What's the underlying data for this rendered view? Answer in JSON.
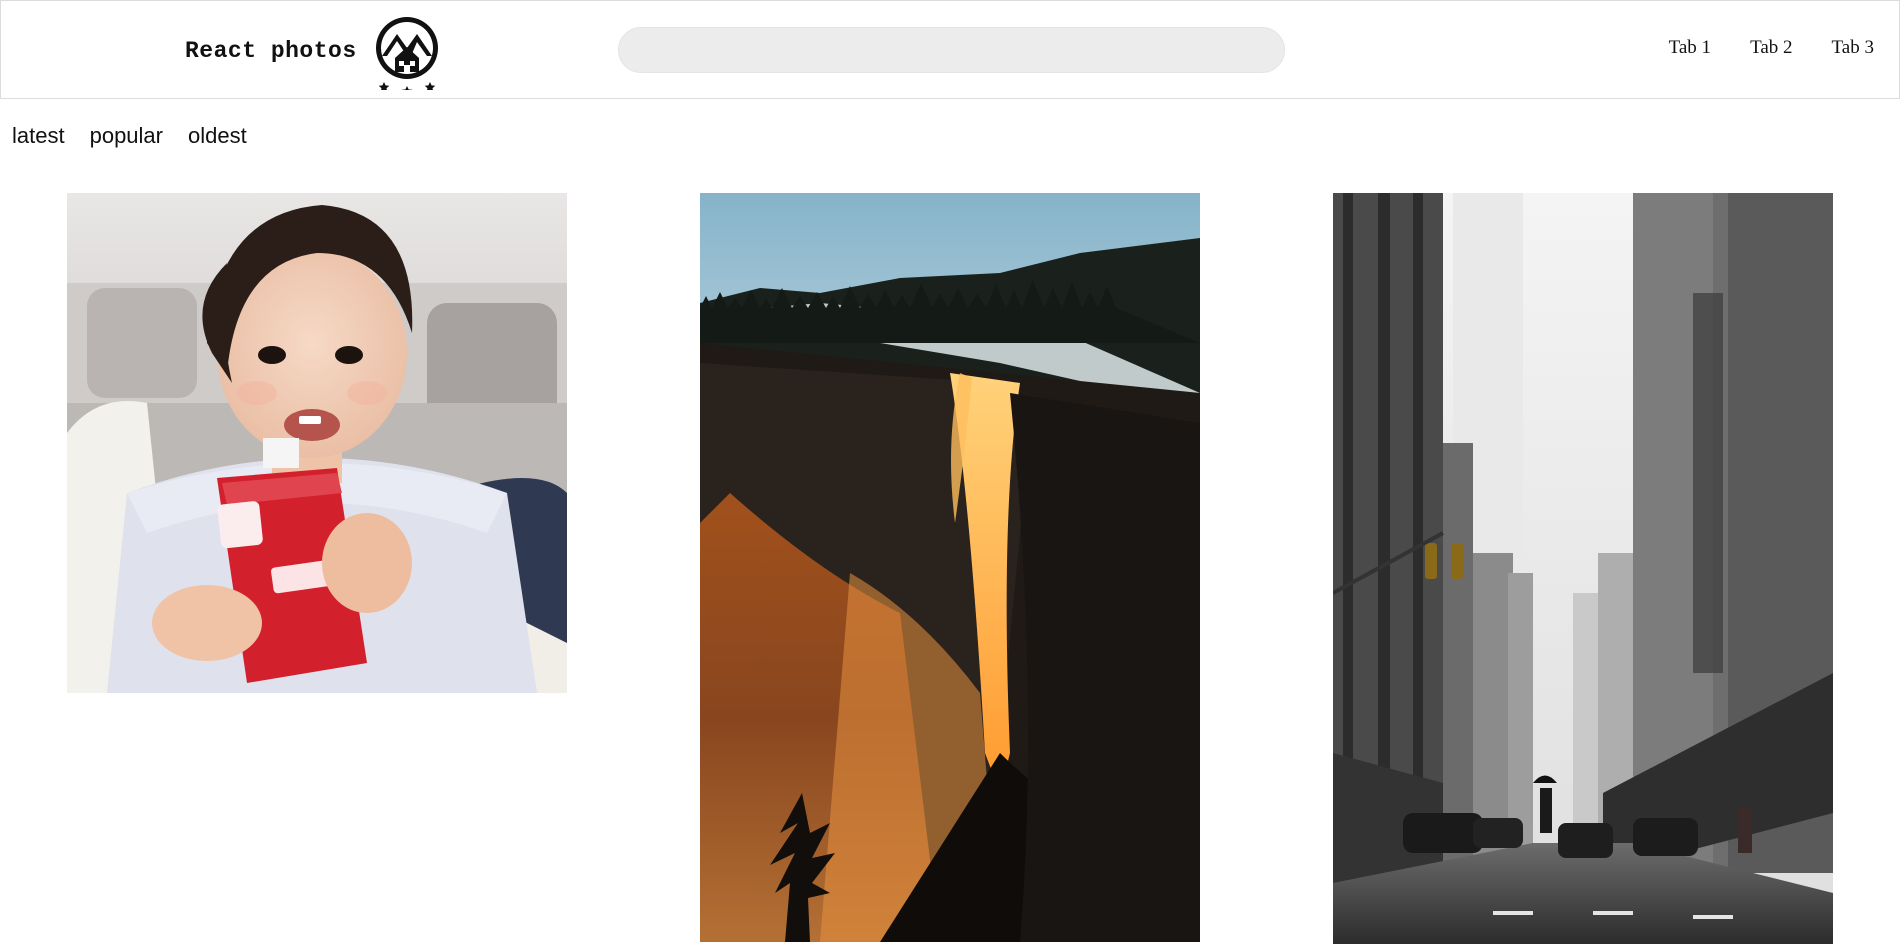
{
  "header": {
    "brand_name": "React photos",
    "search": {
      "value": "",
      "placeholder": ""
    },
    "tabs": [
      {
        "label": "Tab 1"
      },
      {
        "label": "Tab 2"
      },
      {
        "label": "Tab 3"
      }
    ]
  },
  "sort": {
    "options": [
      {
        "label": "latest"
      },
      {
        "label": "popular"
      },
      {
        "label": "oldest"
      }
    ]
  },
  "gallery": {
    "photos": [
      {
        "subject": "toddler holding a red baby food pouch"
      },
      {
        "subject": "glowing orange waterfall on a dark cliff"
      },
      {
        "subject": "rainy city street between tall buildings"
      }
    ]
  }
}
